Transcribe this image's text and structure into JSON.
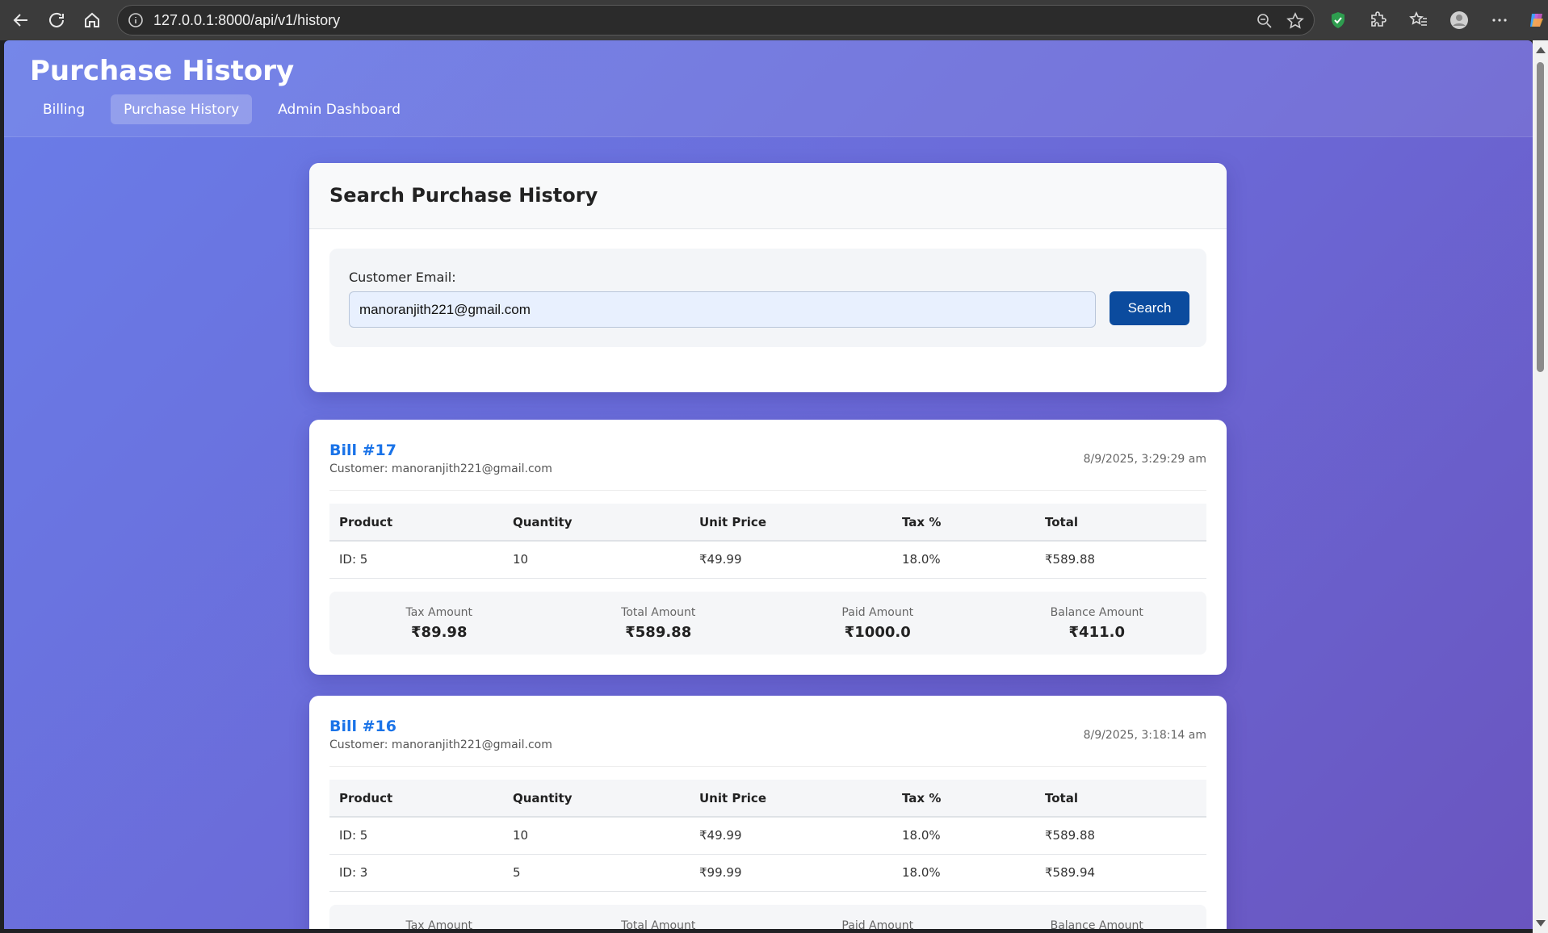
{
  "browser": {
    "url": "127.0.0.1:8000/api/v1/history"
  },
  "app": {
    "title": "Purchase History",
    "tabs": [
      {
        "label": "Billing",
        "active": false
      },
      {
        "label": "Purchase History",
        "active": true
      },
      {
        "label": "Admin Dashboard",
        "active": false
      }
    ]
  },
  "search": {
    "heading": "Search Purchase History",
    "email_label": "Customer Email:",
    "email_value": "manoranjith221@gmail.com",
    "button_label": "Search"
  },
  "columns": [
    "Product",
    "Quantity",
    "Unit Price",
    "Tax %",
    "Total"
  ],
  "summary_labels": [
    "Tax Amount",
    "Total Amount",
    "Paid Amount",
    "Balance Amount"
  ],
  "bills": [
    {
      "title": "Bill #17",
      "customer": "Customer: manoranjith221@gmail.com",
      "date": "8/9/2025, 3:29:29 am",
      "items": [
        {
          "product": "ID: 5",
          "quantity": "10",
          "unit_price": "₹49.99",
          "tax": "18.0%",
          "total": "₹589.88"
        }
      ],
      "summary": {
        "tax_amount": "₹89.98",
        "total_amount": "₹589.88",
        "paid_amount": "₹1000.0",
        "balance_amount": "₹411.0"
      }
    },
    {
      "title": "Bill #16",
      "customer": "Customer: manoranjith221@gmail.com",
      "date": "8/9/2025, 3:18:14 am",
      "items": [
        {
          "product": "ID: 5",
          "quantity": "10",
          "unit_price": "₹49.99",
          "tax": "18.0%",
          "total": "₹589.88"
        },
        {
          "product": "ID: 3",
          "quantity": "5",
          "unit_price": "₹99.99",
          "tax": "18.0%",
          "total": "₹589.94"
        }
      ]
    }
  ]
}
